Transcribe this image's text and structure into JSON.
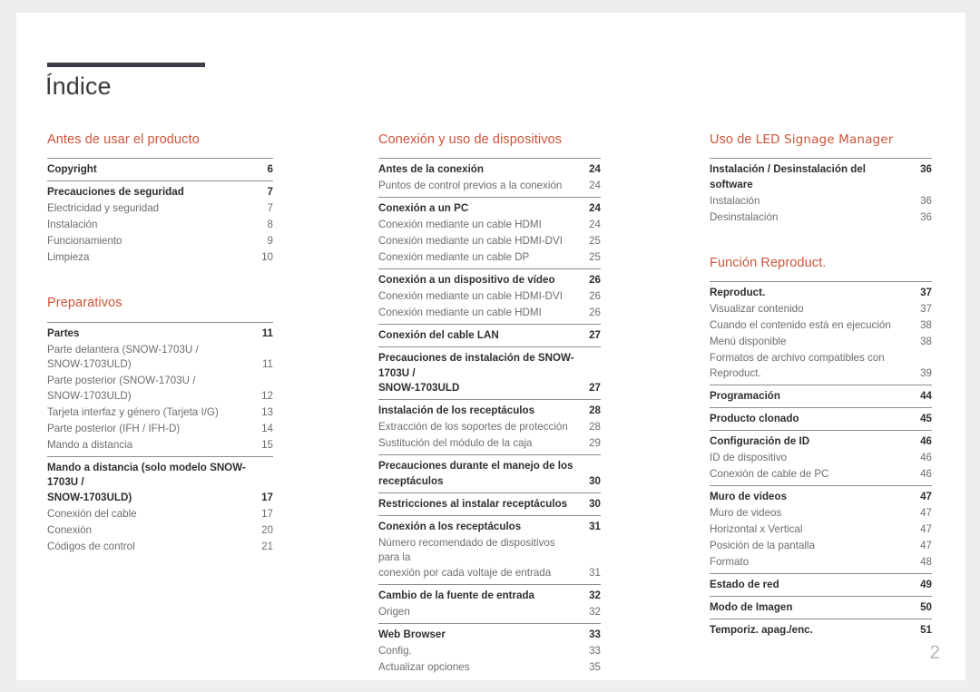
{
  "document": {
    "title": "Índice",
    "folio": "2",
    "accent_color": "#cf5339",
    "rule_color": "#3e3d47",
    "page_background": "#ffffff",
    "canvas_background": "#efeeee"
  },
  "columns": [
    {
      "id": "column-1",
      "sections": [
        {
          "heading": "Antes de usar el producto",
          "heading_parts": [
            {
              "text": "Antes de usar el producto",
              "style": "normal"
            }
          ],
          "groups": [
            {
              "entries": [
                {
                  "label": "Copyright",
                  "page": "6",
                  "level": "main"
                }
              ]
            },
            {
              "entries": [
                {
                  "label": "Precauciones de seguridad",
                  "page": "7",
                  "level": "main"
                },
                {
                  "label": "Electricidad y seguridad",
                  "page": "7",
                  "level": "sub"
                },
                {
                  "label": "Instalación",
                  "page": "8",
                  "level": "sub"
                },
                {
                  "label": "Funcionamiento",
                  "page": "9",
                  "level": "sub"
                },
                {
                  "label": "Limpieza",
                  "page": "10",
                  "level": "sub"
                }
              ]
            }
          ]
        },
        {
          "heading": "Preparativos",
          "heading_parts": [
            {
              "text": "Preparativos",
              "style": "normal"
            }
          ],
          "groups": [
            {
              "entries": [
                {
                  "label": "Partes",
                  "page": "11",
                  "level": "main"
                },
                {
                  "label": "Parte delantera (SNOW-1703U /\nSNOW-1703ULD)",
                  "page": "11",
                  "level": "sub",
                  "wrap": true
                },
                {
                  "label": "Parte posterior (SNOW-1703U /\nSNOW-1703ULD)",
                  "page": "12",
                  "level": "sub",
                  "wrap": true
                },
                {
                  "label": "Tarjeta interfaz y género (Tarjeta I/G)",
                  "page": "13",
                  "level": "sub"
                },
                {
                  "label": "Parte posterior (IFH / IFH-D)",
                  "page": "14",
                  "level": "sub"
                },
                {
                  "label": "Mando a distancia",
                  "page": "15",
                  "level": "sub"
                }
              ]
            },
            {
              "entries": [
                {
                  "label": "Mando a distancia (solo modelo SNOW-1703U /\nSNOW-1703ULD)",
                  "page": "17",
                  "level": "main",
                  "wrap": true
                },
                {
                  "label": "Conexión del cable",
                  "page": "17",
                  "level": "sub"
                },
                {
                  "label": "Conexión",
                  "page": "20",
                  "level": "sub"
                },
                {
                  "label": "Códigos de control",
                  "page": "21",
                  "level": "sub"
                }
              ]
            }
          ]
        }
      ]
    },
    {
      "id": "column-2",
      "sections": [
        {
          "heading": "Conexión y uso de dispositivos",
          "heading_parts": [
            {
              "text": "Conexión y uso de dispositivos",
              "style": "normal"
            }
          ],
          "groups": [
            {
              "entries": [
                {
                  "label": "Antes de la conexión",
                  "page": "24",
                  "level": "main"
                },
                {
                  "label": "Puntos de control previos a la conexión",
                  "page": "24",
                  "level": "sub"
                }
              ]
            },
            {
              "entries": [
                {
                  "label": "Conexión a un PC",
                  "page": "24",
                  "level": "main"
                },
                {
                  "label": "Conexión mediante un cable HDMI",
                  "page": "24",
                  "level": "sub"
                },
                {
                  "label": "Conexión mediante un cable HDMI-DVI",
                  "page": "25",
                  "level": "sub"
                },
                {
                  "label": "Conexión mediante un cable DP",
                  "page": "25",
                  "level": "sub"
                }
              ]
            },
            {
              "entries": [
                {
                  "label": "Conexión a un dispositivo de vídeo",
                  "page": "26",
                  "level": "main"
                },
                {
                  "label": "Conexión mediante un cable HDMI-DVI",
                  "page": "26",
                  "level": "sub"
                },
                {
                  "label": "Conexión mediante un cable HDMI",
                  "page": "26",
                  "level": "sub"
                }
              ]
            },
            {
              "entries": [
                {
                  "label": "Conexión del cable LAN",
                  "page": "27",
                  "level": "main"
                }
              ]
            },
            {
              "entries": [
                {
                  "label": "Precauciones de instalación de SNOW-1703U /\nSNOW-1703ULD",
                  "page": "27",
                  "level": "main",
                  "wrap": true
                }
              ]
            },
            {
              "entries": [
                {
                  "label": "Instalación de los receptáculos",
                  "page": "28",
                  "level": "main"
                },
                {
                  "label": "Extracción de los soportes de protección",
                  "page": "28",
                  "level": "sub"
                },
                {
                  "label": "Sustitución del módulo de la caja",
                  "page": "29",
                  "level": "sub"
                }
              ]
            },
            {
              "entries": [
                {
                  "label": "Precauciones durante el manejo de los\nreceptáculos",
                  "page": "30",
                  "level": "main",
                  "wrap": true
                }
              ]
            },
            {
              "entries": [
                {
                  "label": "Restricciones al instalar receptáculos",
                  "page": "30",
                  "level": "main"
                }
              ]
            },
            {
              "entries": [
                {
                  "label": "Conexión a los receptáculos",
                  "page": "31",
                  "level": "main"
                },
                {
                  "label": "Número recomendado de dispositivos para la\nconexión por cada voltaje de entrada",
                  "page": "31",
                  "level": "sub",
                  "wrap": true
                }
              ]
            },
            {
              "entries": [
                {
                  "label": "Cambio de la fuente de entrada",
                  "page": "32",
                  "level": "main"
                },
                {
                  "label": "Origen",
                  "page": "32",
                  "level": "sub"
                }
              ]
            },
            {
              "entries": [
                {
                  "label": "Web Browser",
                  "page": "33",
                  "level": "main"
                },
                {
                  "label": "Config.",
                  "page": "33",
                  "level": "sub"
                },
                {
                  "label": "Actualizar opciones",
                  "page": "35",
                  "level": "sub"
                }
              ]
            }
          ]
        }
      ]
    },
    {
      "id": "column-3",
      "sections": [
        {
          "heading": "Uso de LED Signage Manager",
          "heading_parts": [
            {
              "text": "Uso de ",
              "style": "normal"
            },
            {
              "text": "LED Signage Manager",
              "style": "alt"
            }
          ],
          "groups": [
            {
              "entries": [
                {
                  "label": "Instalación / Desinstalación del software",
                  "page": "36",
                  "level": "main"
                },
                {
                  "label": "Instalación",
                  "page": "36",
                  "level": "sub"
                },
                {
                  "label": "Desinstalación",
                  "page": "36",
                  "level": "sub"
                }
              ]
            }
          ]
        },
        {
          "heading": "Función Reproduct.",
          "heading_parts": [
            {
              "text": "Función Reproduct.",
              "style": "normal"
            }
          ],
          "groups": [
            {
              "entries": [
                {
                  "label": "Reproduct.",
                  "page": "37",
                  "level": "main"
                },
                {
                  "label": "Visualizar contenido",
                  "page": "37",
                  "level": "sub"
                },
                {
                  "label": "Cuando el contenido está en ejecución",
                  "page": "38",
                  "level": "sub"
                },
                {
                  "label": "Menú disponible",
                  "page": "38",
                  "level": "sub"
                },
                {
                  "label": "Formatos de archivo compatibles con\nReproduct.",
                  "page": "39",
                  "level": "sub",
                  "wrap": true
                }
              ]
            },
            {
              "entries": [
                {
                  "label": "Programación",
                  "page": "44",
                  "level": "main"
                }
              ]
            },
            {
              "entries": [
                {
                  "label": "Producto clonado",
                  "page": "45",
                  "level": "main"
                }
              ]
            },
            {
              "entries": [
                {
                  "label": "Configuración de ID",
                  "page": "46",
                  "level": "main"
                },
                {
                  "label": "ID de dispositivo",
                  "page": "46",
                  "level": "sub"
                },
                {
                  "label": "Conexión de cable de PC",
                  "page": "46",
                  "level": "sub"
                }
              ]
            },
            {
              "entries": [
                {
                  "label": "Muro de videos",
                  "page": "47",
                  "level": "main"
                },
                {
                  "label": "Muro de videos",
                  "page": "47",
                  "level": "sub"
                },
                {
                  "label": "Horizontal x Vertical",
                  "page": "47",
                  "level": "sub"
                },
                {
                  "label": "Posición de la pantalla",
                  "page": "47",
                  "level": "sub"
                },
                {
                  "label": "Formato",
                  "page": "48",
                  "level": "sub"
                }
              ]
            },
            {
              "entries": [
                {
                  "label": "Estado de red",
                  "page": "49",
                  "level": "main"
                }
              ]
            },
            {
              "entries": [
                {
                  "label": "Modo de Imagen",
                  "page": "50",
                  "level": "main"
                }
              ]
            },
            {
              "entries": [
                {
                  "label": "Temporiz. apag./enc.",
                  "page": "51",
                  "level": "main"
                }
              ]
            }
          ]
        }
      ]
    }
  ]
}
